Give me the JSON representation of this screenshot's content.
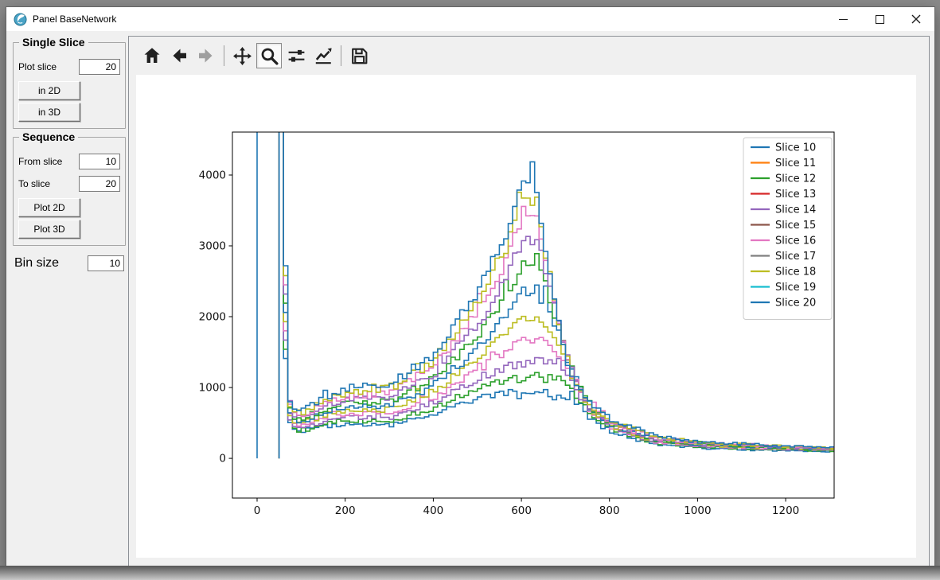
{
  "window": {
    "title": "Panel BaseNetwork"
  },
  "sidebar": {
    "single_slice": {
      "title": "Single Slice",
      "plot_slice_label": "Plot slice",
      "plot_slice_value": "20",
      "btn_2d": "in 2D",
      "btn_3d": "in 3D"
    },
    "sequence": {
      "title": "Sequence",
      "from_label": "From slice",
      "from_value": "10",
      "to_label": "To slice",
      "to_value": "20",
      "btn_2d": "Plot 2D",
      "btn_3d": "Plot 3D"
    },
    "bin_size": {
      "label": "Bin size",
      "value": "10"
    }
  },
  "toolbar": {
    "buttons": [
      {
        "name": "home"
      },
      {
        "name": "back"
      },
      {
        "name": "forward",
        "disabled": true
      },
      {
        "name": "pan"
      },
      {
        "name": "zoom",
        "active": true
      },
      {
        "name": "subplots"
      },
      {
        "name": "customize"
      },
      {
        "name": "save"
      }
    ]
  },
  "chart_data": {
    "type": "step-histogram",
    "title": "",
    "xlabel": "",
    "ylabel": "",
    "xlim": [
      -56,
      1310
    ],
    "ylim": [
      -561,
      4607
    ],
    "xticks": [
      0,
      200,
      400,
      600,
      800,
      1000,
      1200
    ],
    "yticks": [
      0,
      1000,
      2000,
      3000,
      4000
    ],
    "bin_width": 10,
    "grid": false,
    "legend": {
      "position": "upper right",
      "entries": [
        {
          "label": "Slice 10",
          "color": "#1f77b4"
        },
        {
          "label": "Slice 11",
          "color": "#ff7f0e"
        },
        {
          "label": "Slice 12",
          "color": "#2ca02c"
        },
        {
          "label": "Slice 13",
          "color": "#d62728"
        },
        {
          "label": "Slice 14",
          "color": "#9467bd"
        },
        {
          "label": "Slice 15",
          "color": "#8c564b"
        },
        {
          "label": "Slice 16",
          "color": "#e377c2"
        },
        {
          "label": "Slice 17",
          "color": "#7f7f7f"
        },
        {
          "label": "Slice 18",
          "color": "#bcbd22"
        },
        {
          "label": "Slice 19",
          "color": "#17becf"
        },
        {
          "label": "Slice 20",
          "color": "#1f77b4"
        }
      ]
    },
    "note": "Eleven visually distinct stepped histogram outlines (top to bottom at the x=600 peak). Overlapping slice pairs hide five legend colors; a clipped count spike sits at x=0 and in the 50-60 bin of every curve.",
    "control_x": [
      50,
      60,
      70,
      80,
      100,
      150,
      200,
      300,
      400,
      500,
      560,
      600,
      630,
      650,
      680,
      710,
      750,
      800,
      900,
      1000,
      1150,
      1300
    ],
    "curves": [
      {
        "color": "#1f77b4",
        "stem_at_zero": true,
        "values": [
          4700,
          2720,
          800,
          700,
          680,
          860,
          990,
          1050,
          1500,
          2400,
          3150,
          3850,
          3700,
          2950,
          1800,
          1100,
          780,
          540,
          310,
          235,
          185,
          155
        ]
      },
      {
        "color": "#bcbd22",
        "values": [
          4700,
          2580,
          770,
          665,
          645,
          815,
          935,
          985,
          1400,
          2250,
          2980,
          3700,
          3580,
          2900,
          1850,
          1150,
          750,
          515,
          298,
          226,
          178,
          149
        ]
      },
      {
        "color": "#e377c2",
        "values": [
          4700,
          2450,
          740,
          632,
          612,
          772,
          882,
          922,
          1305,
          2105,
          2800,
          3540,
          3460,
          2850,
          1900,
          1200,
          740,
          500,
          287,
          218,
          172,
          144
        ]
      },
      {
        "color": "#9467bd",
        "values": [
          4700,
          2320,
          710,
          600,
          580,
          730,
          830,
          862,
          1215,
          1930,
          2520,
          3150,
          3100,
          2650,
          1900,
          1230,
          730,
          487,
          277,
          210,
          166,
          139
        ]
      },
      {
        "color": "#2ca02c",
        "values": [
          4700,
          2190,
          680,
          568,
          549,
          688,
          779,
          803,
          1128,
          1760,
          2260,
          2810,
          2800,
          2450,
          1850,
          1240,
          720,
          474,
          267,
          202,
          160,
          134
        ]
      },
      {
        "color": "#1f77b4",
        "values": [
          4700,
          2060,
          650,
          537,
          519,
          647,
          728,
          745,
          1043,
          1590,
          2000,
          2350,
          2370,
          2150,
          1750,
          1230,
          710,
          461,
          257,
          194,
          154,
          129
        ]
      },
      {
        "color": "#bcbd22",
        "values": [
          4700,
          1930,
          620,
          506,
          489,
          607,
          678,
          688,
          960,
          1430,
          1760,
          1990,
          2010,
          1900,
          1620,
          1200,
          700,
          448,
          247,
          186,
          148,
          124
        ]
      },
      {
        "color": "#e377c2",
        "values": [
          4700,
          1800,
          590,
          476,
          460,
          567,
          628,
          632,
          878,
          1280,
          1530,
          1670,
          1700,
          1650,
          1480,
          1150,
          690,
          435,
          237,
          178,
          142,
          119
        ]
      },
      {
        "color": "#9467bd",
        "values": [
          4700,
          1670,
          560,
          446,
          431,
          528,
          579,
          577,
          798,
          1130,
          1310,
          1350,
          1360,
          1340,
          1280,
          1080,
          670,
          420,
          226,
          169,
          135,
          113
        ]
      },
      {
        "color": "#2ca02c",
        "values": [
          4700,
          1540,
          530,
          416,
          402,
          489,
          530,
          522,
          719,
          990,
          1110,
          1130,
          1150,
          1130,
          1100,
          980,
          640,
          400,
          214,
          159,
          127,
          106
        ]
      },
      {
        "color": "#1f77b4",
        "values": [
          4700,
          1410,
          500,
          386,
          373,
          450,
          481,
          467,
          640,
          850,
          920,
          880,
          890,
          880,
          870,
          820,
          580,
          360,
          195,
          145,
          115,
          95
        ]
      }
    ]
  }
}
